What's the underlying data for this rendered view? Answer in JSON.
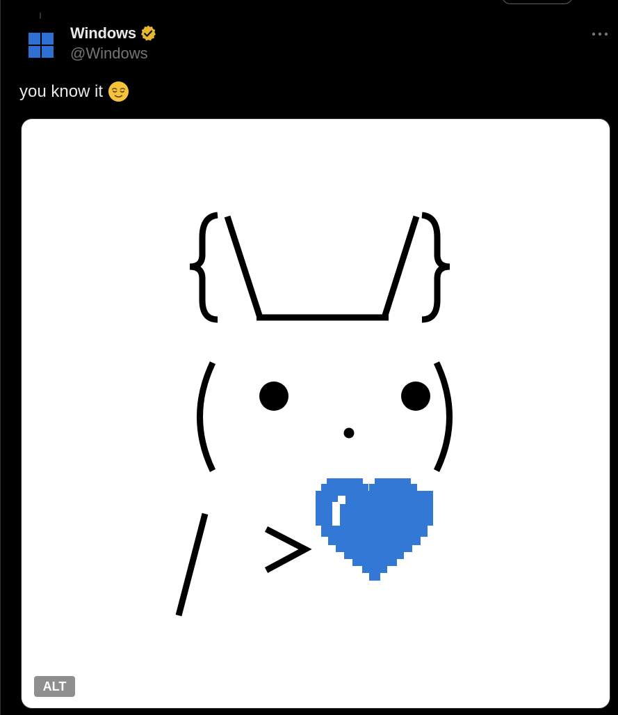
{
  "account": {
    "display_name": "Windows",
    "handle": "@Windows",
    "verified": true,
    "badge_color": "#E8B730",
    "logo_color": "#2E6FD4"
  },
  "tweet": {
    "text": "you know it",
    "emoji": "relieved-face",
    "more_label": "•••"
  },
  "media": {
    "alt_label": "ALT",
    "art": {
      "ears": "{\\___/}",
      "face": "( •   • )",
      "nose": "•",
      "arm": "/",
      "hand": ">",
      "heart_color": "#3478D6"
    }
  }
}
